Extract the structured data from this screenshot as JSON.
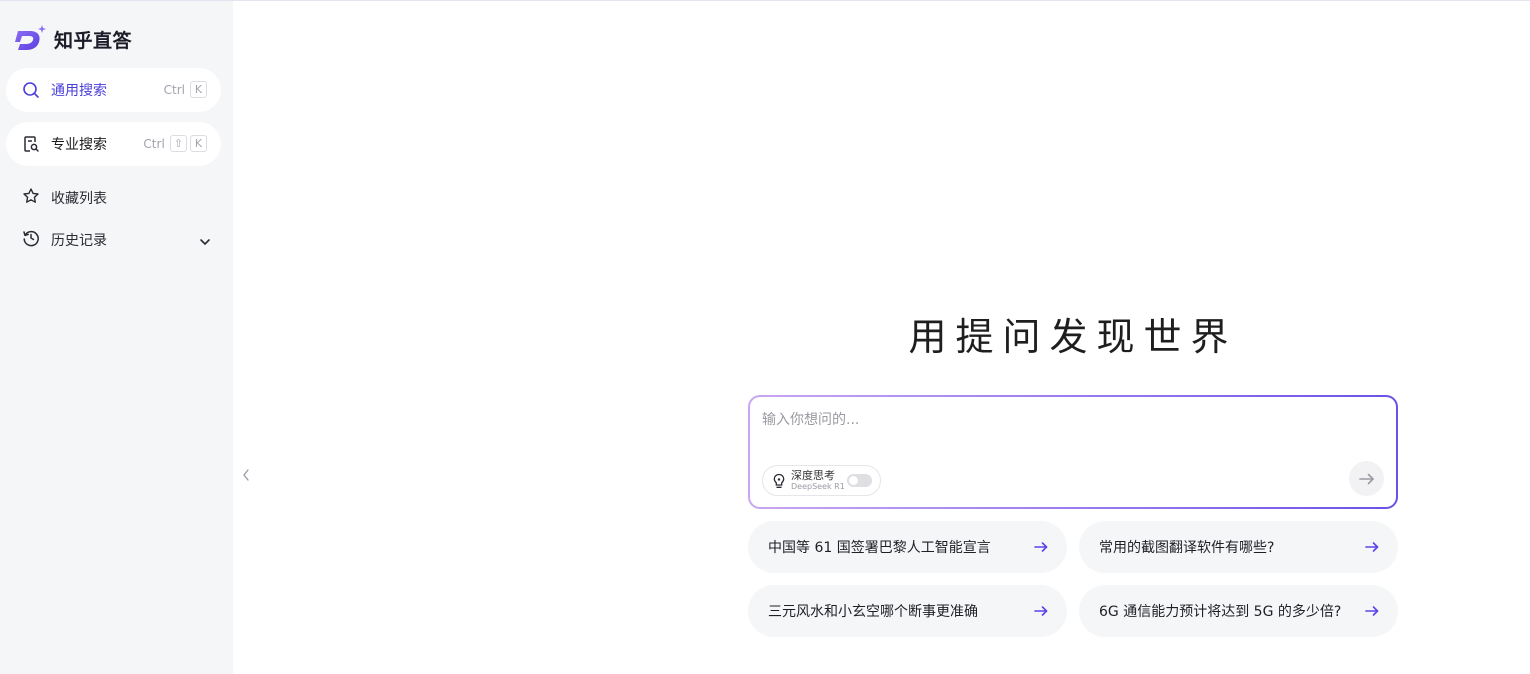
{
  "brand": {
    "name": "知乎直答",
    "logo_icon": "zhida-logo-icon",
    "accent": "#6a4ff0"
  },
  "sidebar": {
    "general_search": {
      "label": "通用搜索",
      "icon": "search-icon",
      "shortcut": [
        "Ctrl",
        "K"
      ],
      "color": "#4b3fd9"
    },
    "pro_search": {
      "label": "专业搜索",
      "icon": "document-search-icon",
      "shortcut": [
        "Ctrl",
        "⇧",
        "K"
      ]
    },
    "favorites": {
      "label": "收藏列表",
      "icon": "star-icon"
    },
    "history": {
      "label": "历史记录",
      "icon": "history-icon",
      "expand_icon": "chevron-down-icon"
    }
  },
  "main": {
    "hero_title": "用提问发现世界",
    "composer": {
      "placeholder": "输入你想问的...",
      "deep_think": {
        "title": "深度思考",
        "subtitle": "DeepSeek R1",
        "enabled": false
      },
      "send_icon": "arrow-right-icon"
    },
    "suggestions": [
      {
        "text": "中国等 61 国签署巴黎人工智能宣言"
      },
      {
        "text": "常用的截图翻译软件有哪些?"
      },
      {
        "text": "三元风水和小玄空哪个断事更准确"
      },
      {
        "text": "6G 通信能力预计将达到 5G 的多少倍?"
      }
    ]
  }
}
